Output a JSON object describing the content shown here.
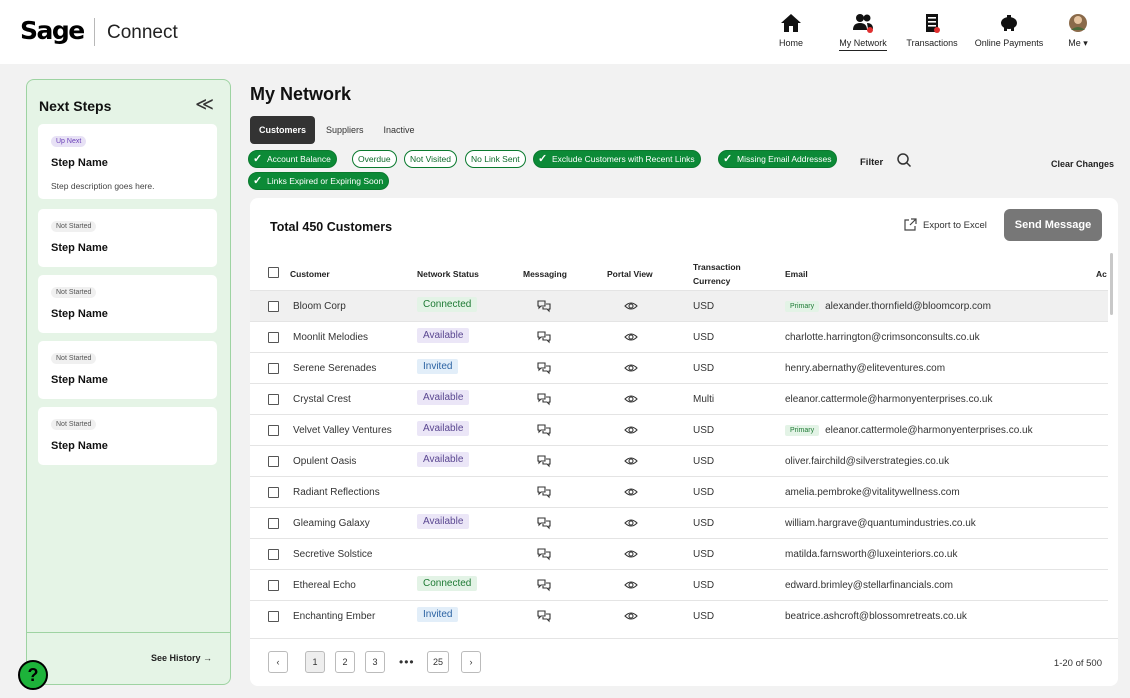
{
  "app": {
    "logo": "Sage",
    "name": "Connect"
  },
  "nav": [
    {
      "label": "Home",
      "icon": "home-icon"
    },
    {
      "label": "My Network",
      "icon": "network-icon"
    },
    {
      "label": "Transactions",
      "icon": "receipt-icon"
    },
    {
      "label": "Online Payments",
      "icon": "piggy-bank-icon"
    },
    {
      "label": "Me ▾",
      "icon": "avatar-icon"
    }
  ],
  "sidebar": {
    "title": "Next Steps",
    "collapse": "≪",
    "steps": [
      {
        "badge": "Up Next",
        "name": "Step Name",
        "desc": "Step description goes here."
      },
      {
        "badge": "Not Started",
        "name": "Step Name"
      },
      {
        "badge": "Not Started",
        "name": "Step Name"
      },
      {
        "badge": "Not Started",
        "name": "Step Name"
      },
      {
        "badge": "Not Started",
        "name": "Step Name"
      }
    ],
    "see_history": "See History →"
  },
  "help": "?",
  "page": {
    "title": "My Network",
    "tabs": [
      "Customers",
      "Suppliers",
      "Inactive"
    ],
    "active_tab": "Customers"
  },
  "filters": {
    "chips": [
      {
        "label": "Account Balance",
        "on": true
      },
      {
        "label": "Overdue",
        "on": false
      },
      {
        "label": "Not Visited",
        "on": false
      },
      {
        "label": "No Link Sent",
        "on": false
      },
      {
        "label": "Exclude Customers with Recent Links",
        "on": true
      },
      {
        "label": "Missing Email Addresses",
        "on": true
      },
      {
        "label": "Links Expired or Expiring Soon",
        "on": true
      }
    ],
    "filter_label": "Filter",
    "clear": "Clear Changes"
  },
  "table": {
    "total": "Total 450 Customers",
    "export": "Export to Excel",
    "send": "Send Message",
    "headers": {
      "customer": "Customer",
      "status": "Network Status",
      "messaging": "Messaging",
      "portal": "Portal View",
      "currency_1": "Transaction",
      "currency_2": "Currency",
      "email": "Email",
      "extra": "Ac"
    },
    "rows": [
      {
        "name": "Bloom Corp",
        "status": "Connected",
        "currency": "USD",
        "primary": "Primary",
        "email": "alexander.thornfield@bloomcorp.com"
      },
      {
        "name": "Moonlit Melodies",
        "status": "Available",
        "currency": "USD",
        "primary": "",
        "email": "charlotte.harrington@crimsonconsults.co.uk"
      },
      {
        "name": "Serene Serenades",
        "status": "Invited",
        "currency": "USD",
        "primary": "",
        "email": "henry.abernathy@eliteventures.com"
      },
      {
        "name": "Crystal Crest",
        "status": "Available",
        "currency": "Multi",
        "primary": "",
        "email": "eleanor.cattermole@harmonyenterprises.co.uk"
      },
      {
        "name": "Velvet Valley Ventures",
        "status": "Available",
        "currency": "USD",
        "primary": "Primary",
        "email": "eleanor.cattermole@harmonyenterprises.co.uk"
      },
      {
        "name": "Opulent Oasis",
        "status": "Available",
        "currency": "USD",
        "primary": "",
        "email": "oliver.fairchild@silverstrategies.co.uk"
      },
      {
        "name": "Radiant Reflections",
        "status": "",
        "currency": "USD",
        "primary": "",
        "email": "amelia.pembroke@vitalitywellness.com"
      },
      {
        "name": "Gleaming Galaxy",
        "status": "Available",
        "currency": "USD",
        "primary": "",
        "email": "william.hargrave@quantumindustries.co.uk"
      },
      {
        "name": "Secretive Solstice",
        "status": "",
        "currency": "USD",
        "primary": "",
        "email": "matilda.farnsworth@luxeinteriors.co.uk"
      },
      {
        "name": "Ethereal Echo",
        "status": "Connected",
        "currency": "USD",
        "primary": "",
        "email": "edward.brimley@stellarfinancials.com"
      },
      {
        "name": "Enchanting Ember",
        "status": "Invited",
        "currency": "USD",
        "primary": "",
        "email": "beatrice.ashcroft@blossomretreats.co.uk"
      }
    ]
  },
  "pagination": {
    "prev": "‹",
    "pages": [
      "1",
      "2",
      "3"
    ],
    "ellipsis": "•••",
    "last": "25",
    "next": "›",
    "current": "1",
    "range": "1-20 of 500"
  }
}
